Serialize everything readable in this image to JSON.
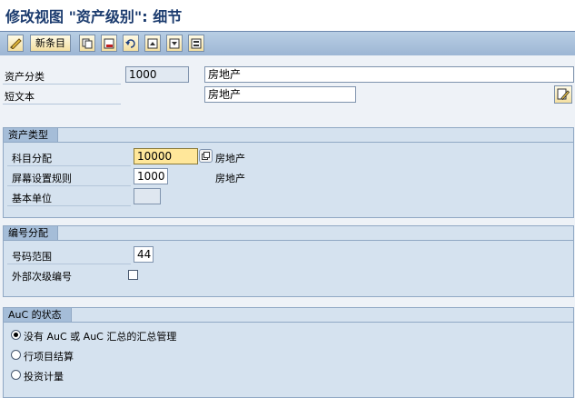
{
  "window": {
    "title": "修改视图 \"资产级别\": 细节"
  },
  "toolbar": {
    "new_entries_label": "新条目",
    "icons": [
      "edit-glasses-icon",
      "copy-icon",
      "delete-icon",
      "undo-icon",
      "previous-entry-icon",
      "next-entry-icon",
      "select-all-icon"
    ]
  },
  "header": {
    "asset_class_label": "资产分类",
    "asset_class_value": "1000",
    "asset_class_desc": "房地产",
    "short_text_label": "短文本",
    "short_text_value": "房地产"
  },
  "asset_type": {
    "title": "资产类型",
    "acct_det_label": "科目分配",
    "acct_det_value": "10000",
    "acct_det_desc": "房地产",
    "screen_layout_label": "屏幕设置规则",
    "screen_layout_value": "1000",
    "screen_layout_desc": "房地产",
    "base_unit_label": "基本单位",
    "base_unit_value": ""
  },
  "number_assignment": {
    "title": "编号分配",
    "number_range_label": "号码范围",
    "number_range_value": "44",
    "external_sub_label": "外部次级编号",
    "external_sub_checked": false
  },
  "auc_status": {
    "title": "AuC 的状态",
    "options": [
      {
        "label": "没有 AuC 或 AuC 汇总的汇总管理",
        "selected": true
      },
      {
        "label": "行项目结算",
        "selected": false
      },
      {
        "label": "投资计量",
        "selected": false
      }
    ]
  }
}
